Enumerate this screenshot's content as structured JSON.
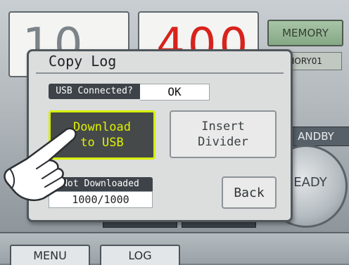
{
  "background": {
    "left_display": "10",
    "right_display": "400",
    "memory_button": "MEMORY",
    "memory_label": "MORY01",
    "standby": "ANDBY",
    "ready": "EADY",
    "bottom_tabs": [
      "MENU",
      "LOG"
    ]
  },
  "dialog": {
    "title": "Copy Log",
    "usb_connected_label": "USB Connected?",
    "usb_connected_value": "OK",
    "download_button": "Download\nto USB",
    "insert_button": "Insert\nDivider",
    "not_downloaded_label": "Not Downloaded",
    "not_downloaded_value": "1000/1000",
    "back_button": "Back"
  },
  "colors": {
    "highlight": "#d6f000",
    "display_red": "#d8231c",
    "display_grey": "#7d8489"
  },
  "icons": {
    "pointer": "pointing-hand-icon"
  }
}
